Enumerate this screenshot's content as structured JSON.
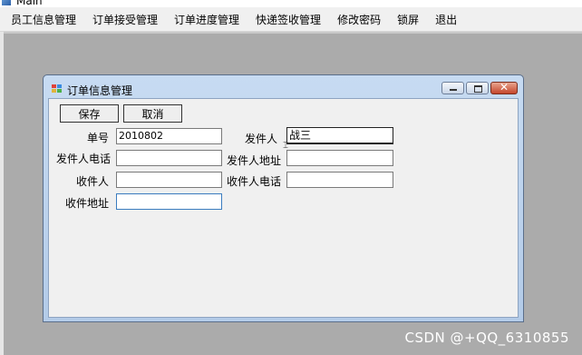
{
  "app": {
    "title": "Main"
  },
  "menu": {
    "items": [
      {
        "label": "员工信息管理"
      },
      {
        "label": "订单接受管理"
      },
      {
        "label": "订单进度管理"
      },
      {
        "label": "快递签收管理"
      },
      {
        "label": "修改密码"
      },
      {
        "label": "锁屏"
      },
      {
        "label": "退出"
      }
    ]
  },
  "child_window": {
    "title": "订单信息管理",
    "save_label": "保存",
    "cancel_label": "取消",
    "fields": {
      "order_no": {
        "label": "单号",
        "value": "2010802"
      },
      "sender": {
        "label": "发件人",
        "value": "战三"
      },
      "sender_phone": {
        "label": "发件人电话",
        "value": ""
      },
      "sender_addr": {
        "label": "发件人地址",
        "value": ""
      },
      "recipient": {
        "label": "收件人",
        "value": ""
      },
      "recipient_phone": {
        "label": "收件人电话",
        "value": ""
      },
      "recipient_addr": {
        "label": "收件地址",
        "value": ""
      }
    }
  },
  "watermark": "CSDN @+QQ_6310855",
  "colors": {
    "desktop_bg": "#ababab",
    "menubar_bg": "#f0f0f0",
    "window_frame": "#b9cfea",
    "close_button": "#c4452b"
  }
}
